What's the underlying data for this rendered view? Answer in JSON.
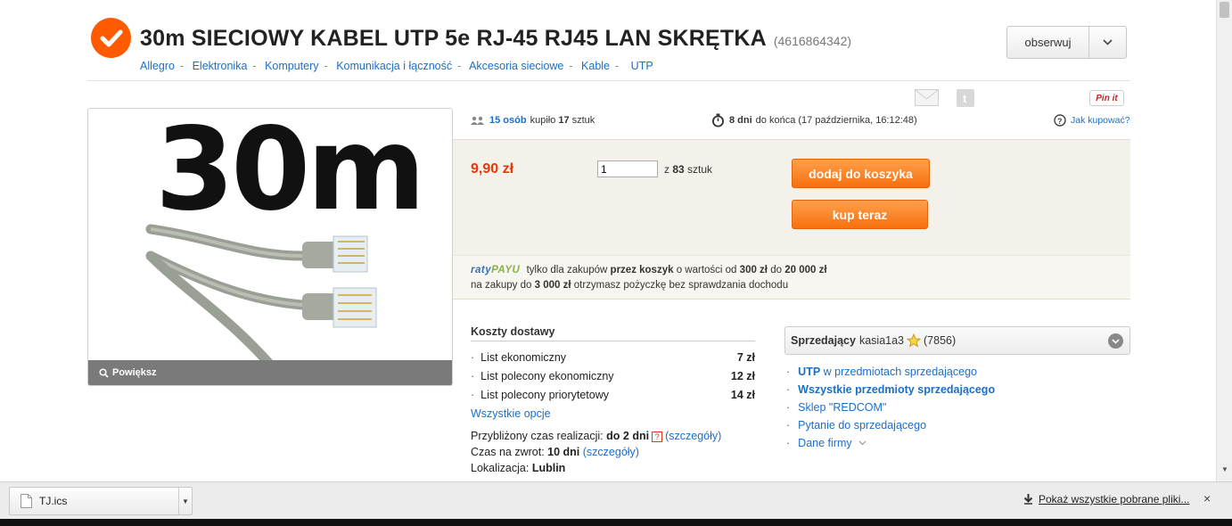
{
  "header": {
    "title": "30m SIECIOWY KABEL UTP 5e RJ-45 RJ45 LAN SKRĘTKA",
    "item_id": "(4616864342)",
    "follow_label": "obserwuj"
  },
  "breadcrumb": [
    "Allegro",
    "Elektronika",
    "Komputery",
    "Komunikacja i łączność",
    "Akcesoria sieciowe",
    "Kable",
    "UTP"
  ],
  "share": {
    "pinit_label": "Pin it"
  },
  "image": {
    "overlay_text": "30m",
    "zoom_label": "Powiększ"
  },
  "stats": {
    "buyers_link": "15 osób",
    "bought_text": "kupiło",
    "bought_count": "17",
    "units": "sztuk",
    "days_left": "8 dni",
    "end_text": "do końca (17 października, 16:12:48)",
    "how_to_buy": "Jak kupować?"
  },
  "buy": {
    "price": "9,90 zł",
    "quantity_value": "1",
    "of_label": "z",
    "available": "83",
    "units": "sztuk",
    "add_to_cart": "dodaj do koszyka",
    "buy_now": "kup teraz"
  },
  "raty": {
    "brand_a": "raty",
    "brand_b": "PAYU",
    "line1_a": "tylko dla zakupów",
    "line1_b": "przez koszyk",
    "line1_c": "o wartości od",
    "line1_d": "300 zł",
    "line1_e": "do",
    "line1_f": "20 000 zł",
    "line2_a": "na zakupy do",
    "line2_b": "3 000 zł",
    "line2_c": "otrzymasz pożyczkę bez sprawdzania dochodu"
  },
  "shipping": {
    "title": "Koszty dostawy",
    "rows": [
      {
        "name": "List ekonomiczny",
        "price": "7 zł"
      },
      {
        "name": "List polecony ekonomiczny",
        "price": "12 zł"
      },
      {
        "name": "List polecony priorytetowy",
        "price": "14 zł"
      }
    ],
    "all_options": "Wszystkie opcje",
    "realization_label": "Przybliżony czas realizacji:",
    "realization_value": "do 2 dni",
    "details": "(szczegóły)",
    "return_label": "Czas na zwrot:",
    "return_value": "10 dni",
    "location_label": "Lokalizacja:",
    "location_value": "Lublin"
  },
  "seller": {
    "label": "Sprzedający",
    "name": "kasia1a3",
    "rating": "(7856)",
    "links": {
      "utp_bold": "UTP",
      "utp_rest": "w przedmiotach sprzedającego",
      "all_items": "Wszystkie przedmioty sprzedającego",
      "shop": "Sklep \"REDCOM\"",
      "ask": "Pytanie do sprzedającego",
      "company": "Dane firmy"
    }
  },
  "downloads": {
    "file_name": "TJ.ics",
    "show_all": "Pokaż wszystkie pobrane pliki...",
    "close": "×"
  }
}
